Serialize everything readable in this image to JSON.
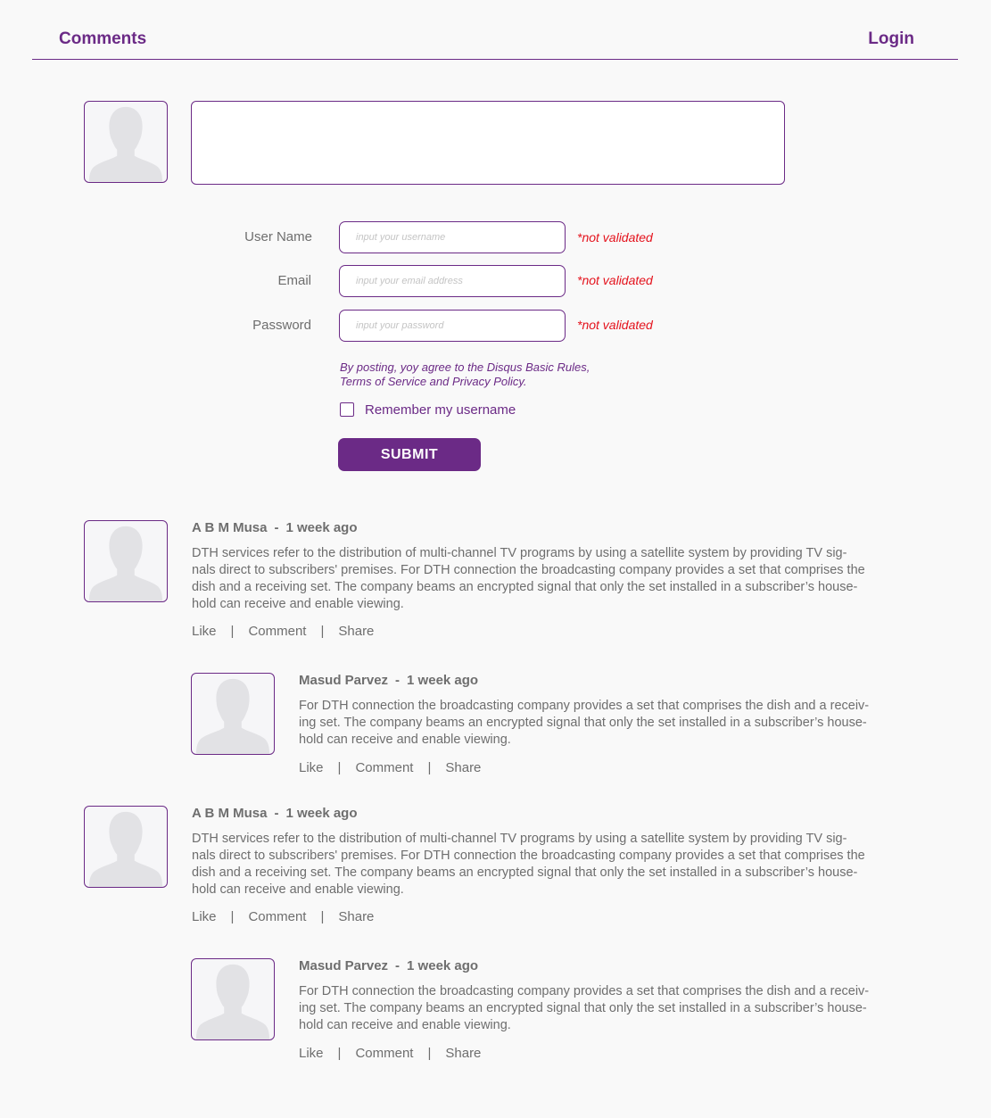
{
  "header": {
    "title": "Comments",
    "login": "Login"
  },
  "form": {
    "username": {
      "label": "User Name",
      "placeholder": "input your username",
      "status": "*not validated"
    },
    "email": {
      "label": "Email",
      "placeholder": "input your email address",
      "status": "*not validated"
    },
    "password": {
      "label": "Password",
      "placeholder": "input your password",
      "status": "*not validated"
    },
    "terms_line1": "By posting, yoy agree to the Disqus Basic Rules,",
    "terms_line2": "Terms of Service and Privacy Policy.",
    "remember_label": "Remember my username",
    "submit_label": "SUBMIT"
  },
  "comments": [
    {
      "author": "A B M Musa",
      "separator": "-",
      "time": "1 week ago",
      "lines": [
        "DTH services refer to the distribution of multi-channel TV programs by using a satellite system by providing TV sig-",
        "nals direct to subscribers' premises. For DTH connection the broadcasting company provides a set that comprises the",
        "dish and a receiving set. The company beams an encrypted signal that only the set installed in a subscriber’s house-",
        "hold can receive and enable viewing."
      ],
      "actions": {
        "like": "Like",
        "comment": "Comment",
        "share": "Share",
        "sep": "|"
      }
    },
    {
      "author": "Masud Parvez",
      "separator": "-",
      "time": "1 week ago",
      "lines": [
        "For DTH connection the broadcasting company provides a set that comprises the dish and a receiv-",
        "ing set. The company beams an encrypted signal that only the set installed in a subscriber’s house-",
        "hold can receive and enable viewing."
      ],
      "actions": {
        "like": "Like",
        "comment": "Comment",
        "share": "Share",
        "sep": "|"
      }
    },
    {
      "author": "A B M Musa",
      "separator": "-",
      "time": "1 week ago",
      "lines": [
        "DTH services refer to the distribution of multi-channel TV programs by using a satellite system by providing TV sig-",
        "nals direct to subscribers' premises. For DTH connection the broadcasting company provides a set that comprises the",
        "dish and a receiving set. The company beams an encrypted signal that only the set installed in a subscriber’s house-",
        "hold can receive and enable viewing."
      ],
      "actions": {
        "like": "Like",
        "comment": "Comment",
        "share": "Share",
        "sep": "|"
      }
    },
    {
      "author": "Masud Parvez",
      "separator": "-",
      "time": "1 week ago",
      "lines": [
        "For DTH connection the broadcasting company provides a set that comprises the dish and a receiv-",
        "ing set. The company beams an encrypted signal that only the set installed in a subscriber’s house-",
        "hold can receive and enable viewing."
      ],
      "actions": {
        "like": "Like",
        "comment": "Comment",
        "share": "Share",
        "sep": "|"
      }
    }
  ],
  "colors": {
    "accent": "#6b2a86",
    "error": "#e4121c",
    "text": "#6e6e6e",
    "background": "#f9f9f9"
  },
  "icons": {
    "avatar": "user-silhouette-icon",
    "checkbox": "checkbox-unchecked-icon"
  }
}
